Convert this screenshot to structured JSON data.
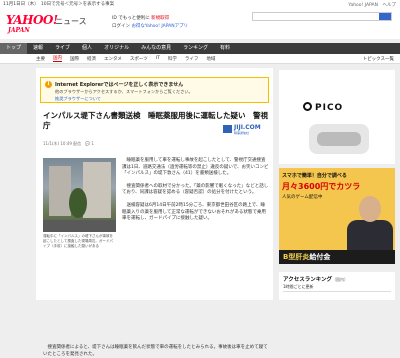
{
  "topstrip": {
    "left": "11月1日日（木）　10日で元号＜元号＞を表示する事案",
    "right": "Yahoo! JAPAN　ヘルプ"
  },
  "header": {
    "logo": "YAHOO!",
    "logo_sub": "JAPAN",
    "news_label": "ニュース",
    "line1_prefix": "ID でもっと便利に",
    "line1_link": "新規取得",
    "line2_prefix": "ログイン",
    "line2_link": "お得なYahoo! JAPANアプリ"
  },
  "nav": [
    "トップ",
    "速報",
    "ライブ",
    "個人",
    "オリジナル",
    "みんなの意見",
    "ランキング",
    "有料"
  ],
  "subnav": {
    "items": [
      "主要",
      "国内",
      "国際",
      "経済",
      "エンタメ",
      "スポーツ",
      "IT",
      "科学",
      "ライフ",
      "地域"
    ],
    "selected": "国内",
    "right": "トピックス一覧"
  },
  "ie_warning": {
    "icon": "i",
    "title": "Internet Explorerではページを正しく表示できません",
    "body": "他のブラウザーからアクセスするか、スマートフォンからご覧ください。",
    "link": "推奨ブラウザーについて"
  },
  "article": {
    "headline": "インパルス堤下さん書類送検　睡眠薬服用後に運転した疑い　警視庁",
    "source_name": "JIJI.COM",
    "source_sub": "時事通信社",
    "meta": "11/1(木) 10:49 配信　💬 1",
    "caption": "運転中に「インパルス」の堤下さんが事故を起こしたとして捜査した現場周辺。ガードパイプ（手前）に接触した疑いがある",
    "paragraphs": [
      "睡眠薬を服用して車を運転し事故を起こしたとして、警視庁交通捜査課は1日、道路交通法（過労運転等の禁止）違反の疑いで、お笑いコンビ「インパルス」の堤下敦さん（41）を書類送検した。",
      "捜査関係者への取材で分かった。「薬の影響で眠くなった」などと話しており、同課は容疑を認める（容疑否認）の処分を付けたという。",
      "送検容疑は6月14日午前2時15分ごろ、東京都世田谷区の路上で、睡眠薬入りの薬を服用して正常な運転ができないおそれがある状態で乗用車を運転し、ガードパイプに接触した疑い。"
    ],
    "bottom": "捜査関係者によると、堤下さんは睡眠薬を飲んだ状態で車の運転をしたとみられる。事故後は車を止めて寝ていたところを発見された。"
  },
  "ads": {
    "pico": "PICO",
    "hair_top": "スマホで簡単！自分で調べる",
    "hair_big": "月々3600円でカツラ",
    "hair_mid": "人気のゲーム配信中",
    "hair_bar_red": "B型肝炎",
    "hair_bar_white": "給付金"
  },
  "ranking": {
    "title": "アクセスランキング",
    "sub": "（国内）",
    "tab": "1時間ごとに更新"
  },
  "colors": {
    "nav_bg": "#3b3b3b",
    "yahoo_red": "#ff0033",
    "warn_border": "#f2c200",
    "link_blue": "#2a5fd6"
  }
}
